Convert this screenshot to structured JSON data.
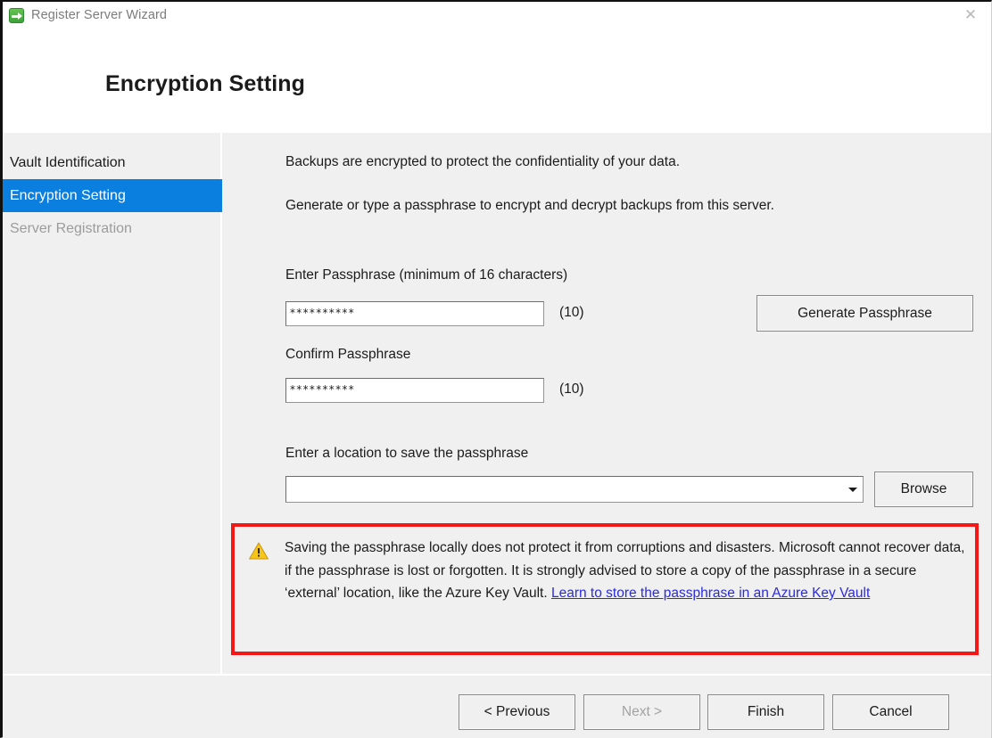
{
  "window": {
    "title": "Register Server Wizard",
    "icon": "green-arrow-icon",
    "close_label": "✕"
  },
  "header": {
    "title": "Encryption Setting"
  },
  "sidebar": {
    "items": [
      {
        "label": "Vault Identification",
        "state": "normal"
      },
      {
        "label": "Encryption Setting",
        "state": "selected"
      },
      {
        "label": "Server Registration",
        "state": "disabled"
      }
    ]
  },
  "main": {
    "intro_line_1": "Backups are encrypted to protect the confidentiality of your data.",
    "intro_line_2": "Generate or type a passphrase to encrypt and decrypt backups from this server.",
    "passphrase": {
      "label": "Enter Passphrase (minimum of 16 characters)",
      "value": "**********",
      "count": "(10)"
    },
    "confirm": {
      "label": "Confirm Passphrase",
      "value": "**********",
      "count": "(10)"
    },
    "generate_button": "Generate Passphrase",
    "location": {
      "label": "Enter a location to save the passphrase",
      "value": "",
      "placeholder": ""
    },
    "browse_button": "Browse"
  },
  "warning": {
    "icon": "warning-triangle-icon",
    "text": "Saving the passphrase locally does not protect it from corruptions and disasters. Microsoft cannot recover data, if the passphrase is lost or forgotten. It is strongly advised to store a copy of the passphrase in a secure ‘external’ location, like the Azure Key Vault. ",
    "link_text": "Learn to store the passphrase in an Azure Key Vault",
    "border_color": "#f51616",
    "link_color": "#2a2adf"
  },
  "footer": {
    "previous": "< Previous",
    "next": "Next >",
    "finish": "Finish",
    "cancel": "Cancel",
    "next_disabled": true
  },
  "colors": {
    "accent_blue": "#0a7fe0",
    "panel_gray": "#f0f0f0",
    "warning_red": "#f51616"
  }
}
